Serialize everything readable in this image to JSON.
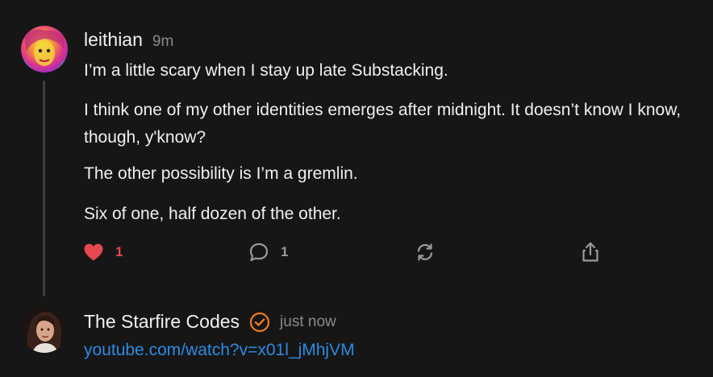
{
  "thread": [
    {
      "author": "leithian",
      "time": "9m",
      "paragraphs": [
        "I’m a little scary when I stay up late Substacking.",
        "I think one of my other identities emerges after midnight. It doesn’t know I know, though, y'know?",
        "The other possibility is I’m a gremlin.",
        "Six of one, half dozen of the other."
      ],
      "actions": {
        "like_count": "1",
        "liked": true,
        "comment_count": "1",
        "restack_icon": "restack-icon",
        "share_icon": "share-icon"
      }
    },
    {
      "author": "The Starfire Codes",
      "verified": true,
      "time": "just now",
      "link": "youtube.com/watch?v=x01l_jMhjVM"
    }
  ],
  "colors": {
    "background": "#161616",
    "text": "#f2f2f2",
    "muted": "#8a8a8a",
    "like": "#e5484d",
    "link": "#2f8ae0",
    "verified": "#f07b1f",
    "thread_line": "#3d3d3d"
  }
}
